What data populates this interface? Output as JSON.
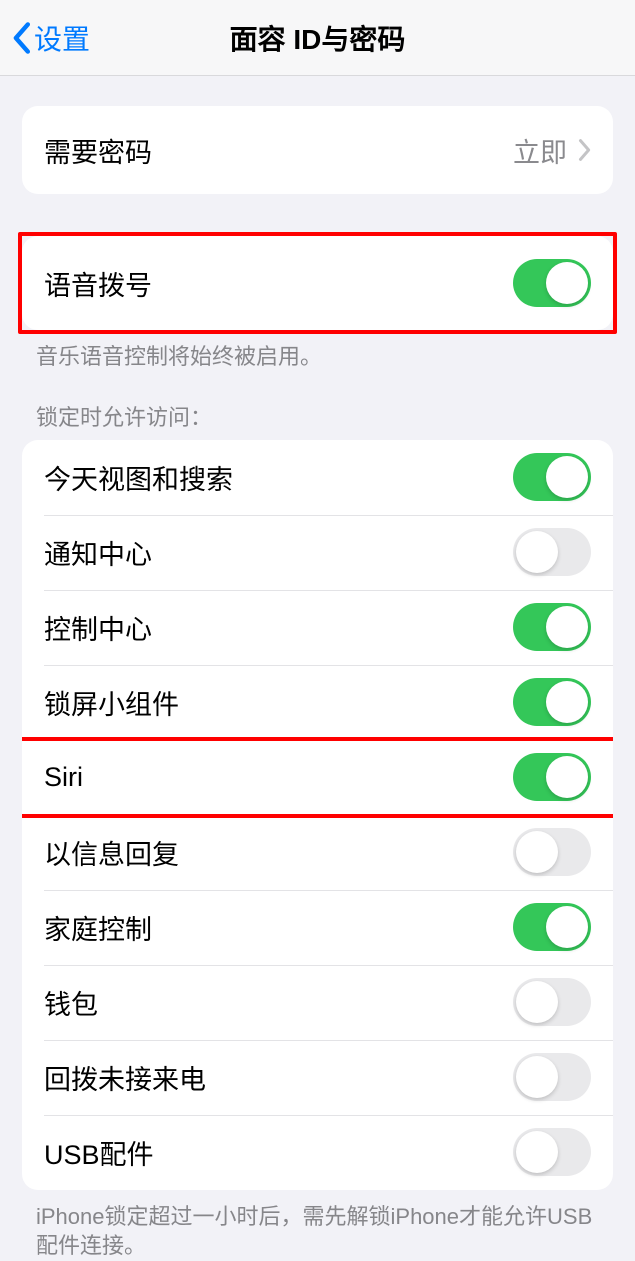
{
  "nav": {
    "back": "设置",
    "title": "面容 ID与密码"
  },
  "require_passcode": {
    "label": "需要密码",
    "value": "立即"
  },
  "voice_dial": {
    "label": "语音拨号",
    "on": true,
    "footer": "音乐语音控制将始终被启用。"
  },
  "lock_access": {
    "header": "锁定时允许访问：",
    "items": [
      {
        "label": "今天视图和搜索",
        "on": true
      },
      {
        "label": "通知中心",
        "on": false
      },
      {
        "label": "控制中心",
        "on": true
      },
      {
        "label": "锁屏小组件",
        "on": true
      },
      {
        "label": "Siri",
        "on": true
      },
      {
        "label": "以信息回复",
        "on": false
      },
      {
        "label": "家庭控制",
        "on": true
      },
      {
        "label": "钱包",
        "on": false
      },
      {
        "label": "回拨未接来电",
        "on": false
      },
      {
        "label": "USB配件",
        "on": false
      }
    ],
    "footer": "iPhone锁定超过一小时后，需先解锁iPhone才能允许USB配件连接。"
  },
  "highlights": {
    "voice_dial_group": true,
    "siri_row": true
  }
}
